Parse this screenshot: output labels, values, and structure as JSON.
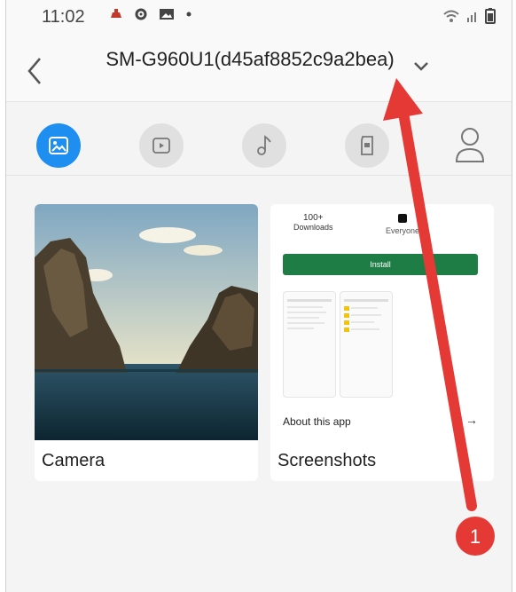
{
  "status_bar": {
    "time": "11:02",
    "left_icons": [
      "notification-icon",
      "settings-icon",
      "gallery-icon",
      "dot-icon"
    ],
    "right_icons": [
      "wifi-icon",
      "signal-icon",
      "battery-icon"
    ]
  },
  "header": {
    "title": "SM-G960U1(d45af8852c9a2bea)",
    "back_icon": "back-arrow-icon",
    "dropdown_icon": "chevron-down-icon"
  },
  "tabs": [
    {
      "name": "photos",
      "icon": "image-icon",
      "active": true
    },
    {
      "name": "videos",
      "icon": "video-icon",
      "active": false
    },
    {
      "name": "music",
      "icon": "music-icon",
      "active": false
    },
    {
      "name": "storage",
      "icon": "sd-card-icon",
      "active": false
    },
    {
      "name": "contacts",
      "icon": "person-icon",
      "active": false
    }
  ],
  "albums": [
    {
      "label": "Camera"
    },
    {
      "label": "Screenshots",
      "preview": {
        "downloads_count": "100+",
        "downloads_label": "Downloads",
        "rating_label": "Everyone",
        "install_label": "Install",
        "about_label": "About this app",
        "about_arrow": "→"
      }
    }
  ],
  "annotation": {
    "badge_number": "1",
    "color": "#e53935"
  },
  "colors": {
    "accent": "#1f8ef1",
    "install_green": "#1e7d45"
  }
}
